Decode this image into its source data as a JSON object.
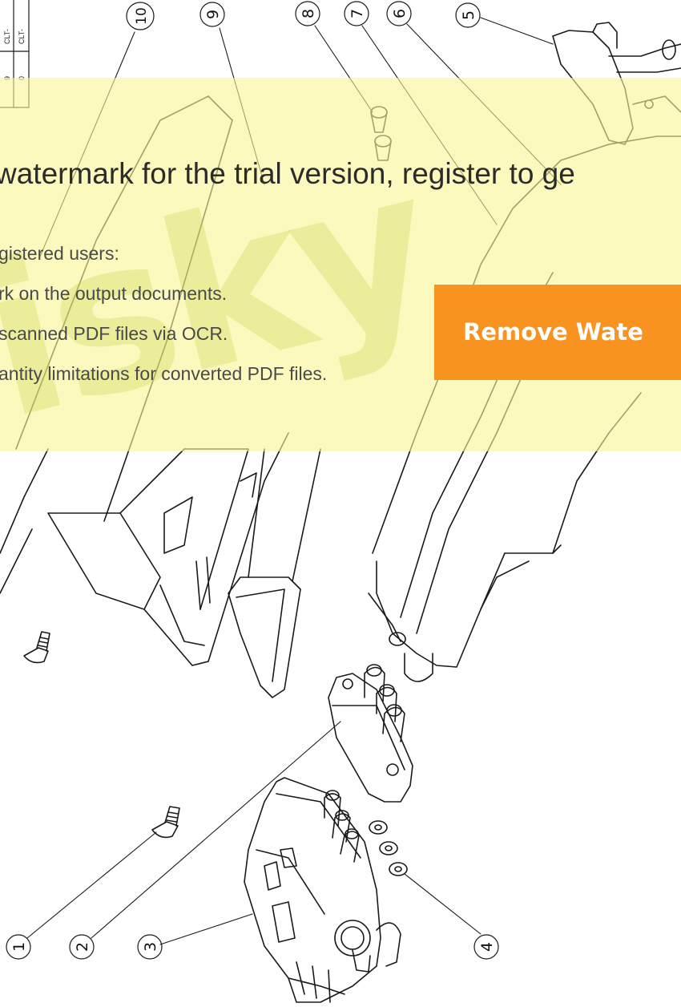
{
  "title_block": {
    "cells": [
      "CLT-",
      "CLT-",
      "9",
      "0"
    ]
  },
  "callouts": [
    "1",
    "2",
    "3",
    "4",
    "5",
    "6",
    "7",
    "8",
    "9",
    "10"
  ],
  "watermark": {
    "title": "watermark for the trial version, register to ge",
    "intro": "gistered users:",
    "benefits": [
      "rk on the output documents.",
      " scanned PDF files via OCR.",
      "antity limitations for converted PDF files."
    ],
    "background_text": "isky",
    "button_label": "Remove Wate",
    "colors": {
      "banner": "#faf696",
      "button": "#f7931e",
      "button_text": "#ffffff"
    }
  }
}
